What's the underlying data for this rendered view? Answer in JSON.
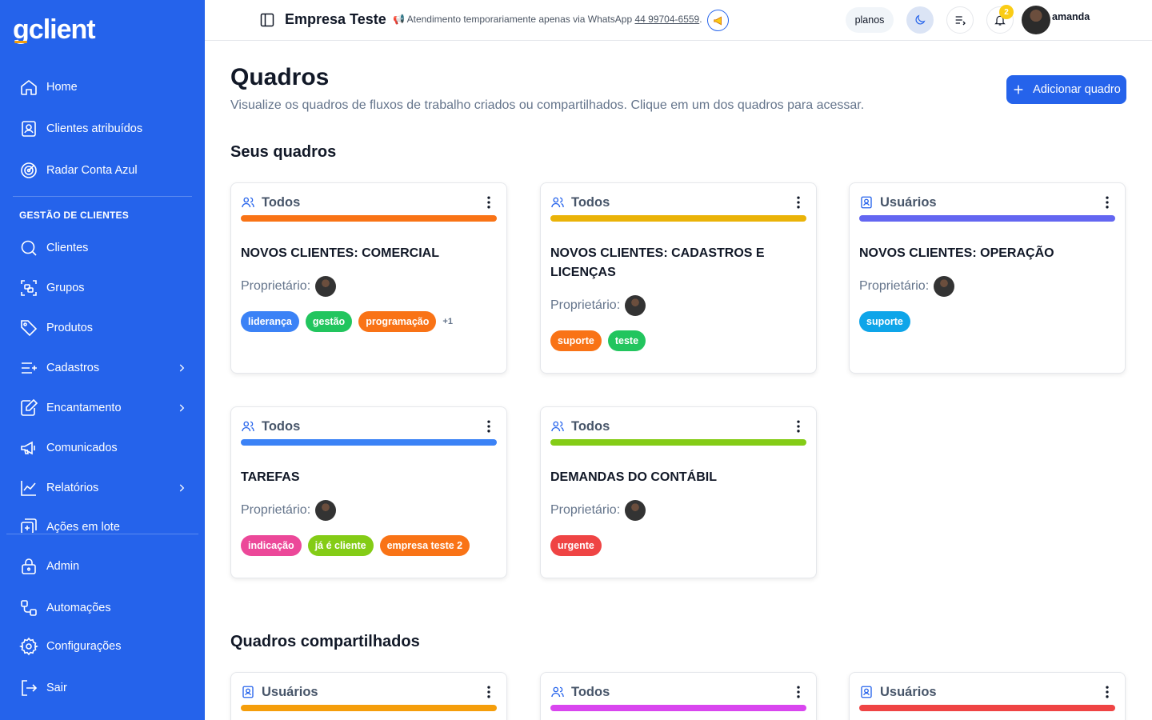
{
  "sidebar": {
    "logo": {
      "g": "g",
      "rest": "client"
    },
    "items_top": [
      {
        "label": "Home",
        "icon": "home-icon"
      },
      {
        "label": "Clientes atribuídos",
        "icon": "id-card-icon"
      },
      {
        "label": "Radar Conta Azul",
        "icon": "radar-icon"
      }
    ],
    "section_label": "GESTÃO DE CLIENTES",
    "items_section": [
      {
        "label": "Clientes",
        "icon": "search-icon"
      },
      {
        "label": "Grupos",
        "icon": "group-icon"
      },
      {
        "label": "Produtos",
        "icon": "tag-icon"
      },
      {
        "label": "Cadastros",
        "icon": "list-plus-icon"
      },
      {
        "label": "Encantamento",
        "icon": "edit-icon"
      },
      {
        "label": "Comunicados",
        "icon": "megaphone-icon"
      },
      {
        "label": "Relatórios",
        "icon": "chart-icon"
      },
      {
        "label": "Ações em lote",
        "icon": "batch-icon"
      }
    ],
    "items_bottom": [
      {
        "label": "Admin",
        "icon": "lock-icon"
      },
      {
        "label": "Automações",
        "icon": "workflow-icon"
      },
      {
        "label": "Configurações",
        "icon": "gear-icon"
      },
      {
        "label": "Sair",
        "icon": "logout-icon"
      }
    ]
  },
  "topbar": {
    "company": "Empresa Teste",
    "notice_emoji": "📢",
    "notice_text": "Atendimento temporariamente apenas via WhatsApp",
    "notice_phone": "44 99704-6559",
    "notice_end": ".",
    "plans_label": "planos",
    "notifications_count": "2",
    "user_name": "amanda"
  },
  "main": {
    "title": "Quadros",
    "subtitle": "Visualize os quadros de fluxos de trabalho criados ou compartilhados. Clique em um dos quadros para acessar.",
    "add_button": "Adicionar quadro",
    "my_boards_title": "Seus quadros",
    "shared_boards_title": "Quadros compartilhados",
    "owner_label": "Proprietário:",
    "my_boards": [
      {
        "access": "Todos",
        "access_icon": "users-icon",
        "color": "#f97316",
        "title": "NOVOS CLIENTES: COMERCIAL",
        "tags": [
          {
            "label": "liderança",
            "color": "#3b82f6"
          },
          {
            "label": "gestão",
            "color": "#22c55e"
          },
          {
            "label": "programação",
            "color": "#f97316"
          }
        ],
        "more": "+1"
      },
      {
        "access": "Todos",
        "access_icon": "users-icon",
        "color": "#eab308",
        "title": "NOVOS CLIENTES: CADASTROS E LICENÇAS",
        "tags": [
          {
            "label": "suporte",
            "color": "#f97316"
          },
          {
            "label": "teste",
            "color": "#22c55e"
          }
        ],
        "more": ""
      },
      {
        "access": "Usuários",
        "access_icon": "user-badge-icon",
        "color": "#6366f1",
        "title": "NOVOS CLIENTES: OPERAÇÃO",
        "tags": [
          {
            "label": "suporte",
            "color": "#0ea5e9"
          }
        ],
        "more": ""
      },
      {
        "access": "Todos",
        "access_icon": "users-icon",
        "color": "#3b82f6",
        "title": "TAREFAS",
        "tags": [
          {
            "label": "indicação",
            "color": "#ec4899"
          },
          {
            "label": "já é cliente",
            "color": "#84cc16"
          },
          {
            "label": "empresa teste 2",
            "color": "#f97316"
          }
        ],
        "more": ""
      },
      {
        "access": "Todos",
        "access_icon": "users-icon",
        "color": "#84cc16",
        "title": "DEMANDAS DO CONTÁBIL",
        "tags": [
          {
            "label": "urgente",
            "color": "#ef4444"
          }
        ],
        "more": ""
      }
    ],
    "shared_boards": [
      {
        "access": "Usuários",
        "access_icon": "user-badge-icon",
        "color": "#f59e0b"
      },
      {
        "access": "Todos",
        "access_icon": "users-icon",
        "color": "#d946ef"
      },
      {
        "access": "Usuários",
        "access_icon": "user-badge-icon",
        "color": "#ef4444"
      }
    ]
  }
}
